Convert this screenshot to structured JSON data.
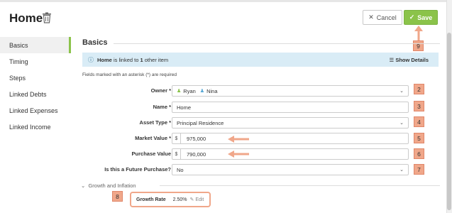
{
  "page": {
    "title": "Home"
  },
  "toolbar": {
    "cancel_label": "Cancel",
    "save_label": "Save"
  },
  "sidebar": {
    "items": [
      {
        "label": "Basics",
        "active": true
      },
      {
        "label": "Timing"
      },
      {
        "label": "Steps"
      },
      {
        "label": "Linked Debts"
      },
      {
        "label": "Linked Expenses"
      },
      {
        "label": "Linked Income"
      }
    ]
  },
  "section": {
    "title": "Basics"
  },
  "info": {
    "name": "Home",
    "mid": "is linked to",
    "count": "1",
    "tail": "other item",
    "show_details": "Show Details"
  },
  "required_note": "Fields marked with an asterisk (*) are required",
  "form": {
    "owner": {
      "label": "Owner *",
      "people": [
        "Ryan",
        "Nina"
      ]
    },
    "name": {
      "label": "Name *",
      "value": "Home"
    },
    "asset_type": {
      "label": "Asset Type *",
      "value": "Principal Residence"
    },
    "market_value": {
      "label": "Market Value *",
      "currency": "$",
      "value": "975,000"
    },
    "purchase_value": {
      "label": "Purchase Value",
      "currency": "$",
      "value": "790,000"
    },
    "future_purchase": {
      "label": "Is this a Future Purchase?",
      "value": "No"
    }
  },
  "growth": {
    "heading": "Growth and Inflation",
    "label": "Growth Rate",
    "value": "2.50%",
    "edit": "Edit"
  },
  "annotations": {
    "save_badge": "9",
    "owner_badge": "2",
    "name_badge": "3",
    "asset_badge": "4",
    "market_badge": "5",
    "purchase_badge": "6",
    "future_badge": "7",
    "growth_badge": "8"
  },
  "colors": {
    "accent": "#8bc34a",
    "annotation": "#f0a78a",
    "info_bg": "#d9ecf6"
  }
}
